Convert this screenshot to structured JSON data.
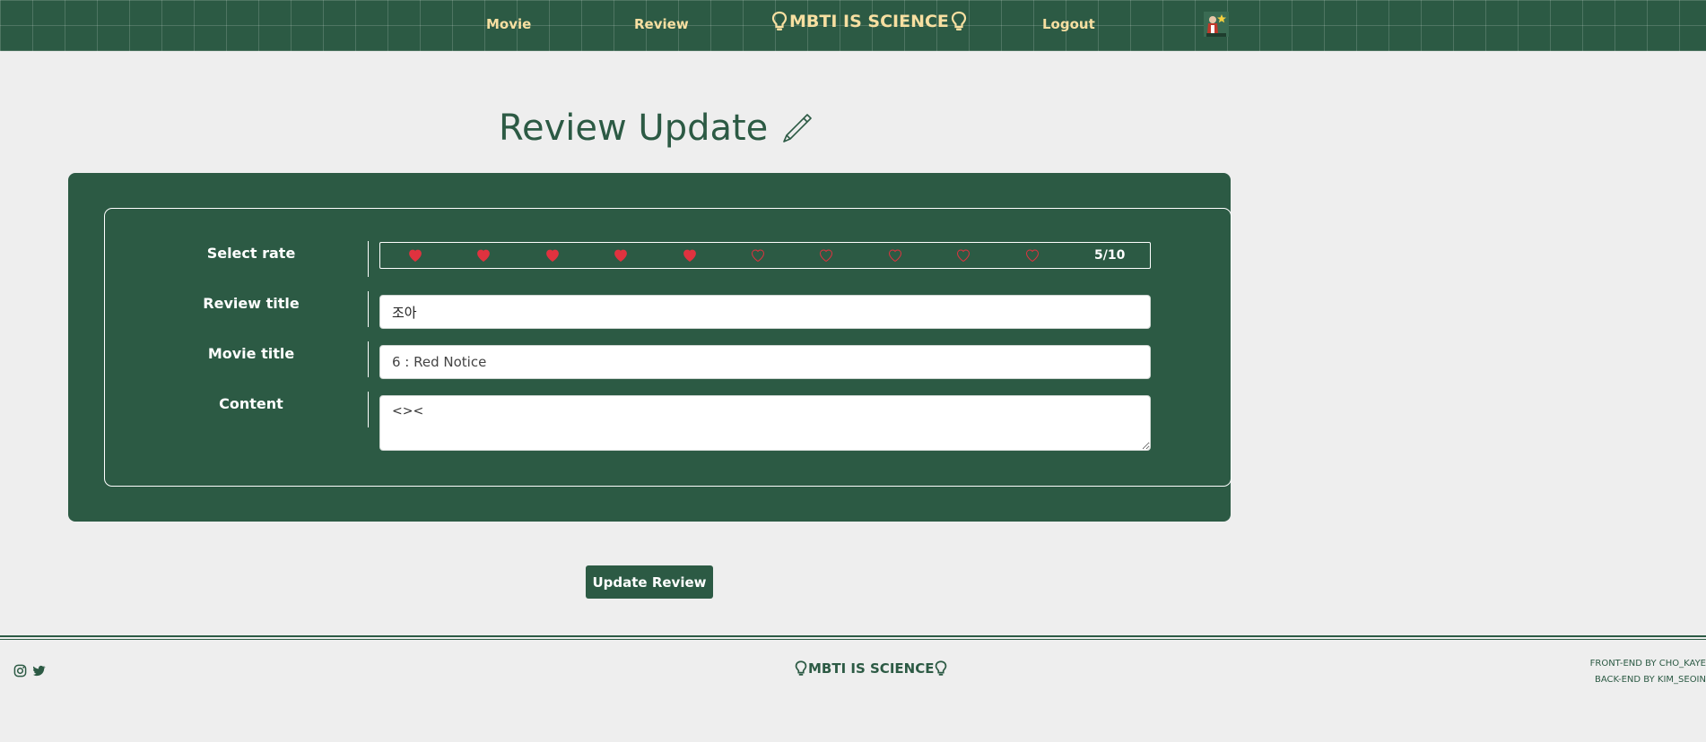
{
  "nav": {
    "movie_label": "Movie",
    "review_label": "Review",
    "brand": "MBTI IS SCIENCE",
    "logout_label": "Logout"
  },
  "page": {
    "title": "Review Update"
  },
  "form": {
    "rate_label": "Select rate",
    "rating": 5,
    "rating_max": 10,
    "rating_text": "5/10",
    "review_title_label": "Review title",
    "review_title_value": "조아",
    "movie_title_label": "Movie title",
    "movie_title_value": "6 : Red Notice",
    "content_label": "Content",
    "content_value": "<><"
  },
  "submit_label": "Update Review",
  "footer": {
    "brand": "MBTI IS SCIENCE",
    "credit_front": "FRONT-END BY CHO_KAYE",
    "credit_back": "BACK-END BY KIM_SEOIN",
    "social": [
      "instagram-icon",
      "twitter-icon"
    ]
  },
  "colors": {
    "primary": "#2c5a44",
    "accent": "#f7dfa1",
    "heart": "#e0323f",
    "background": "#eeeeee"
  }
}
